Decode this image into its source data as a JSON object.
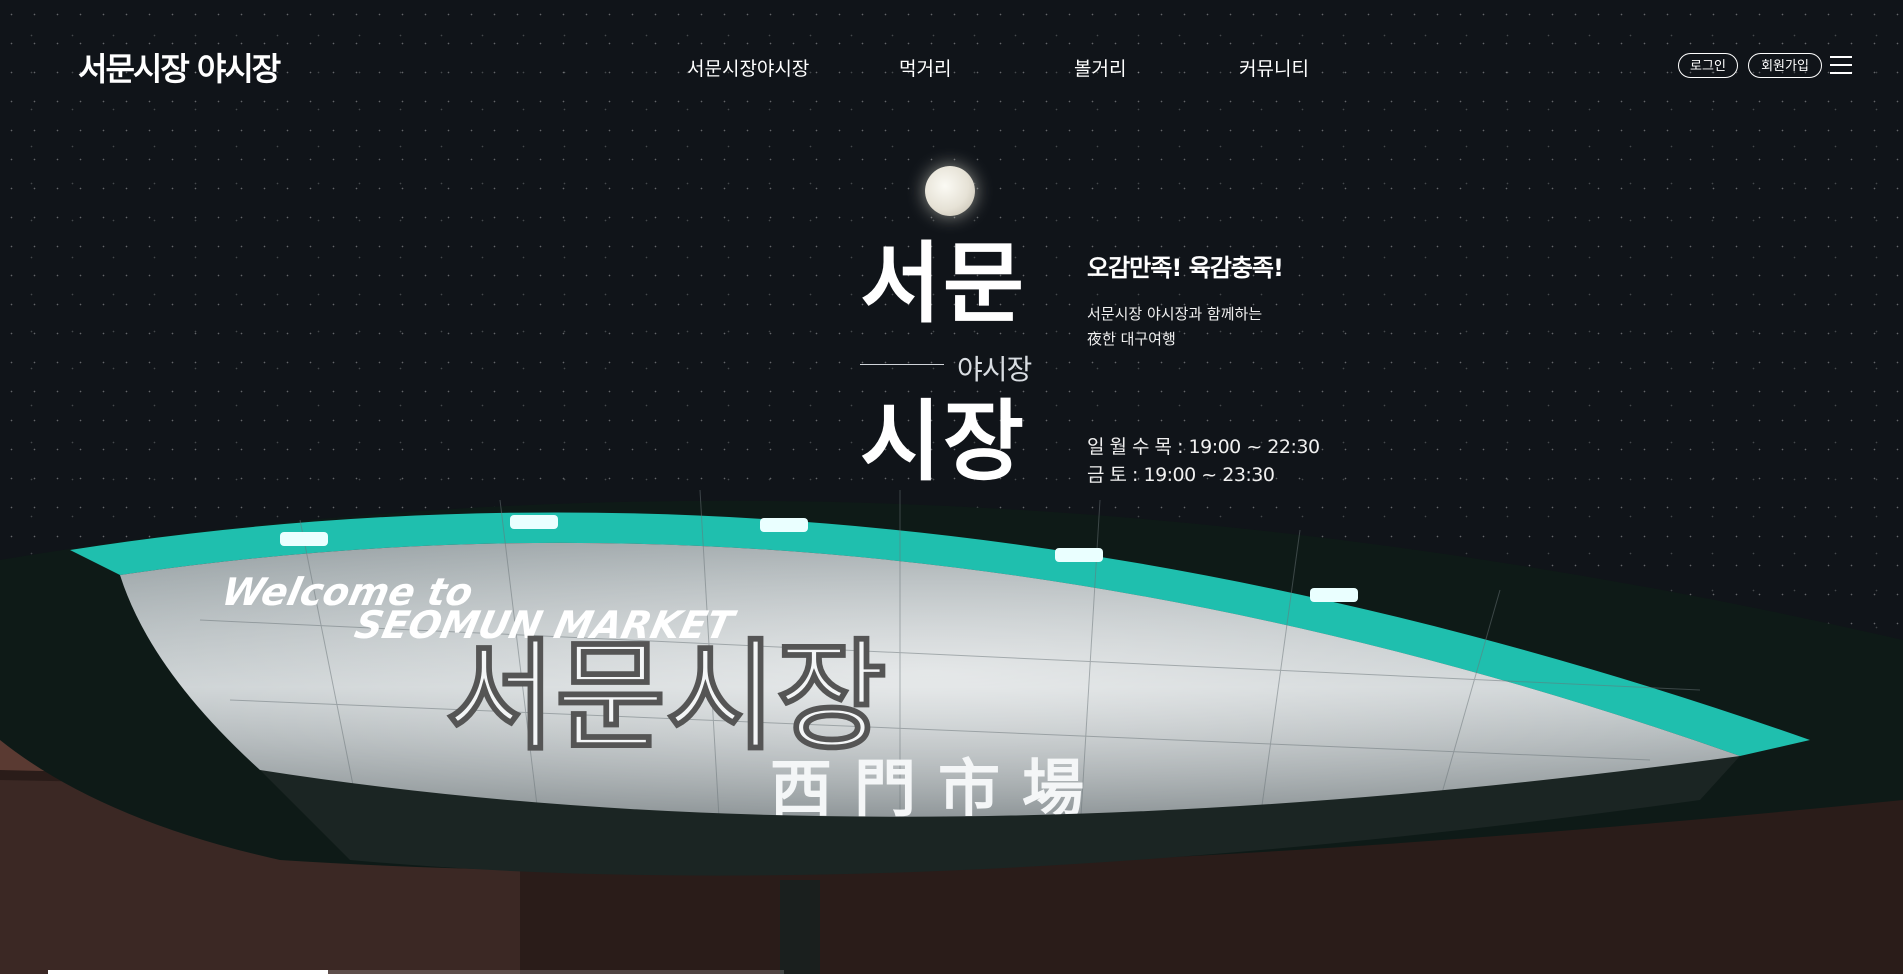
{
  "header": {
    "logo": "서문시장 야시장",
    "nav": [
      "서문시장야시장",
      "먹거리",
      "볼거리",
      "커뮤니티"
    ],
    "login": "로그인",
    "signup": "회원가입",
    "menu_icon": "hamburger-menu-icon"
  },
  "hero": {
    "title_top": "서문",
    "subtitle": "야시장",
    "title_bottom": "시장",
    "slogan": "오감만족! 육감충족!",
    "desc_line1": "서문시장 야시장과 함께하는",
    "desc_line2": "夜한 대구여행",
    "hours_line1": "일 월 수 목 : 19:00 ~ 22:30",
    "hours_line2": "금 토 : 19:00 ~ 23:30"
  },
  "sign": {
    "welcome": "Welcome to",
    "market_en": "SEOMUN MARKET",
    "market_ko": "서문시장",
    "market_hanja": "西門市場"
  },
  "slider": {
    "progress": 0.38
  },
  "colors": {
    "background": "#101419",
    "sign_rim": "#1fbfae",
    "text": "#ffffff"
  }
}
